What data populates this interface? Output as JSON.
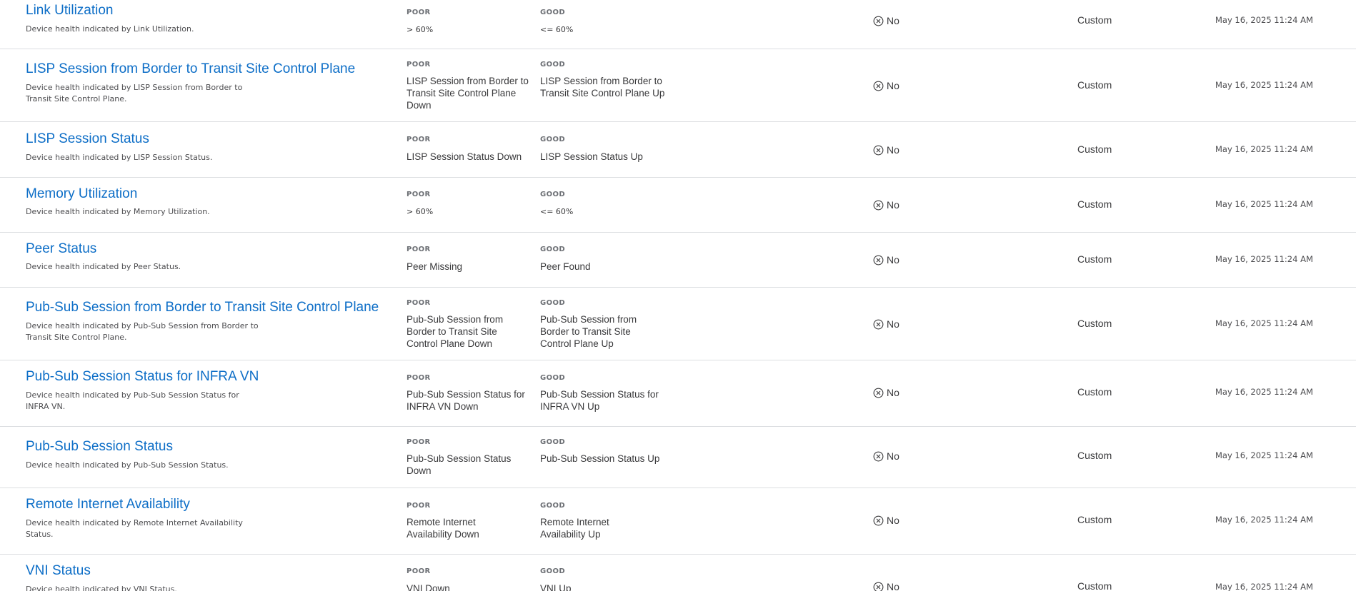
{
  "columns": {
    "poor_label": "POOR",
    "good_label": "GOOD"
  },
  "rows": [
    {
      "name": "Link Utilization",
      "description": "Device health indicated by Link Utilization.",
      "poor": "> 60%",
      "good": "<= 60%",
      "kpi_enabled": "No",
      "type": "Custom",
      "updated": "May 16, 2025 11:24 AM"
    },
    {
      "name": "LISP Session from Border to Transit Site Control Plane",
      "description": "Device health indicated by LISP Session from Border to Transit Site Control Plane.",
      "poor": "LISP Session from Border to Transit Site Control Plane Down",
      "good": "LISP Session from Border to Transit Site Control Plane Up",
      "kpi_enabled": "No",
      "type": "Custom",
      "updated": "May 16, 2025 11:24 AM"
    },
    {
      "name": "LISP Session Status",
      "description": "Device health indicated by LISP Session Status.",
      "poor": "LISP Session Status Down",
      "good": "LISP Session Status Up",
      "kpi_enabled": "No",
      "type": "Custom",
      "updated": "May 16, 2025 11:24 AM"
    },
    {
      "name": "Memory Utilization",
      "description": "Device health indicated by Memory Utilization.",
      "poor": "> 60%",
      "good": "<= 60%",
      "kpi_enabled": "No",
      "type": "Custom",
      "updated": "May 16, 2025 11:24 AM"
    },
    {
      "name": "Peer Status",
      "description": "Device health indicated by Peer Status.",
      "poor": "Peer Missing",
      "good": "Peer Found",
      "kpi_enabled": "No",
      "type": "Custom",
      "updated": "May 16, 2025 11:24 AM"
    },
    {
      "name": "Pub-Sub Session from Border to Transit Site Control Plane",
      "description": "Device health indicated by Pub-Sub Session from Border to Transit Site Control Plane.",
      "poor": "Pub-Sub Session from Border to Transit Site Control Plane Down",
      "good": "Pub-Sub Session from Border to Transit Site Control Plane Up",
      "kpi_enabled": "No",
      "type": "Custom",
      "updated": "May 16, 2025 11:24 AM"
    },
    {
      "name": "Pub-Sub Session Status for INFRA VN",
      "description": "Device health indicated by Pub-Sub Session Status for INFRA VN.",
      "poor": "Pub-Sub Session Status for INFRA VN Down",
      "good": "Pub-Sub Session Status for INFRA VN Up",
      "kpi_enabled": "No",
      "type": "Custom",
      "updated": "May 16, 2025 11:24 AM"
    },
    {
      "name": "Pub-Sub Session Status",
      "description": "Device health indicated by Pub-Sub Session Status.",
      "poor": "Pub-Sub Session Status Down",
      "good": "Pub-Sub Session Status Up",
      "kpi_enabled": "No",
      "type": "Custom",
      "updated": "May 16, 2025 11:24 AM"
    },
    {
      "name": "Remote Internet Availability",
      "description": "Device health indicated by Remote Internet Availability Status.",
      "poor": "Remote Internet Availability Down",
      "good": "Remote Internet Availability Up",
      "kpi_enabled": "No",
      "type": "Custom",
      "updated": "May 16, 2025 11:24 AM"
    },
    {
      "name": "VNI Status",
      "description": "Device health indicated by VNI Status.",
      "poor": "VNI Down",
      "good": "VNI Up",
      "kpi_enabled": "No",
      "type": "Custom",
      "updated": "May 16, 2025 11:24 AM"
    }
  ]
}
